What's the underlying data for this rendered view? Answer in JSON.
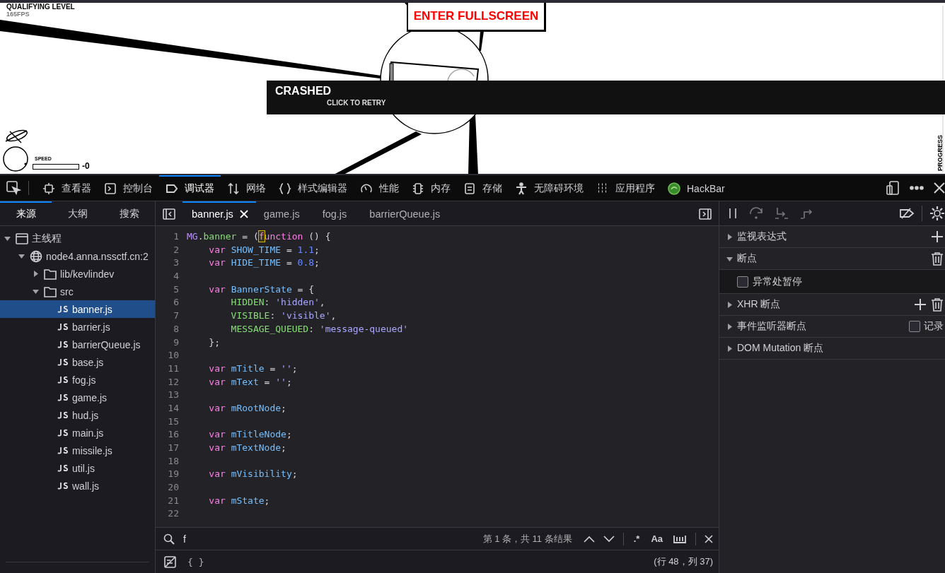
{
  "game": {
    "level_title": "QUALIFYING LEVEL",
    "fps": "165FPS",
    "fullscreen_button": "ENTER FULLSCREEN",
    "banner": {
      "title": "CRASHED",
      "subtitle": "CLICK TO RETRY"
    },
    "speed": {
      "label": "SPEED",
      "value": "-0",
      "level": 0
    },
    "progress_label": "PROGRESS"
  },
  "toolbar": {
    "tabs": [
      {
        "kind": "inspector",
        "label": "查看器",
        "selected": false
      },
      {
        "kind": "console",
        "label": "控制台",
        "selected": false
      },
      {
        "kind": "debugger",
        "label": "调试器",
        "selected": true
      },
      {
        "kind": "network",
        "label": "网络",
        "selected": false
      },
      {
        "kind": "style",
        "label": "样式编辑器",
        "selected": false
      },
      {
        "kind": "performance",
        "label": "性能",
        "selected": false
      },
      {
        "kind": "memory",
        "label": "内存",
        "selected": false
      },
      {
        "kind": "storage",
        "label": "存储",
        "selected": false
      },
      {
        "kind": "accessibility",
        "label": "无障碍环境",
        "selected": false
      },
      {
        "kind": "application",
        "label": "应用程序",
        "selected": false
      },
      {
        "kind": "extension",
        "label": "HackBar",
        "selected": false
      }
    ]
  },
  "sidebar": {
    "tabs": [
      {
        "label": "来源",
        "selected": true
      },
      {
        "label": "大纲",
        "selected": false
      },
      {
        "label": "搜索",
        "selected": false
      }
    ],
    "tree": [
      {
        "kind": "thread",
        "label": "主线程",
        "expanded": true,
        "children": [
          {
            "kind": "host",
            "label": "node4.anna.nssctf.cn:2",
            "expanded": true,
            "children": [
              {
                "kind": "folder",
                "label": "lib/kevlindev",
                "expanded": false
              },
              {
                "kind": "folder",
                "label": "src",
                "expanded": true,
                "children": [
                  {
                    "kind": "file",
                    "label": "banner.js",
                    "selected": true
                  },
                  {
                    "kind": "file",
                    "label": "barrier.js",
                    "selected": false
                  },
                  {
                    "kind": "file",
                    "label": "barrierQueue.js",
                    "selected": false
                  },
                  {
                    "kind": "file",
                    "label": "base.js",
                    "selected": false
                  },
                  {
                    "kind": "file",
                    "label": "fog.js",
                    "selected": false
                  },
                  {
                    "kind": "file",
                    "label": "game.js",
                    "selected": false
                  },
                  {
                    "kind": "file",
                    "label": "hud.js",
                    "selected": false
                  },
                  {
                    "kind": "file",
                    "label": "main.js",
                    "selected": false
                  },
                  {
                    "kind": "file",
                    "label": "missile.js",
                    "selected": false
                  },
                  {
                    "kind": "file",
                    "label": "util.js",
                    "selected": false
                  },
                  {
                    "kind": "file",
                    "label": "wall.js",
                    "selected": false
                  }
                ]
              }
            ]
          }
        ]
      }
    ]
  },
  "editor": {
    "tabs": [
      {
        "label": "banner.js",
        "selected": true
      },
      {
        "label": "game.js",
        "selected": false
      },
      {
        "label": "fog.js",
        "selected": false
      },
      {
        "label": "barrierQueue.js",
        "selected": false
      }
    ],
    "lines": [
      {
        "number": "1",
        "tokens": [
          {
            "kind": "object",
            "text": "MG"
          },
          {
            "kind": "plain",
            "text": "."
          },
          {
            "kind": "property",
            "text": "banner"
          },
          {
            "kind": "plain",
            "text": " = ("
          },
          {
            "kind": "match",
            "text": "f"
          },
          {
            "kind": "keyword",
            "text": "unction"
          },
          {
            "kind": "plain",
            "text": " () {"
          }
        ]
      },
      {
        "number": "2",
        "tokens": [
          {
            "kind": "keyword",
            "text": "    var "
          },
          {
            "kind": "variable",
            "text": "SHOW_TIME"
          },
          {
            "kind": "plain",
            "text": " = "
          },
          {
            "kind": "number",
            "text": "1.1"
          },
          {
            "kind": "plain",
            "text": ";"
          }
        ]
      },
      {
        "number": "3",
        "tokens": [
          {
            "kind": "keyword",
            "text": "    var "
          },
          {
            "kind": "variable",
            "text": "HIDE_TIME"
          },
          {
            "kind": "plain",
            "text": " = "
          },
          {
            "kind": "number",
            "text": "0.8"
          },
          {
            "kind": "plain",
            "text": ";"
          }
        ]
      },
      {
        "number": "4"
      },
      {
        "number": "5",
        "tokens": [
          {
            "kind": "keyword",
            "text": "    var "
          },
          {
            "kind": "variable",
            "text": "BannerState"
          },
          {
            "kind": "plain",
            "text": " = {"
          }
        ]
      },
      {
        "number": "6",
        "tokens": [
          {
            "kind": "property",
            "text": "        HIDDEN"
          },
          {
            "kind": "plain",
            "text": ": "
          },
          {
            "kind": "string",
            "text": "'hidden'"
          },
          {
            "kind": "plain",
            "text": ","
          }
        ]
      },
      {
        "number": "7",
        "tokens": [
          {
            "kind": "property",
            "text": "        VISIBLE"
          },
          {
            "kind": "plain",
            "text": ": "
          },
          {
            "kind": "string",
            "text": "'visible'"
          },
          {
            "kind": "plain",
            "text": ","
          }
        ]
      },
      {
        "number": "8",
        "tokens": [
          {
            "kind": "property",
            "text": "        MESSAGE_QUEUED"
          },
          {
            "kind": "plain",
            "text": ": "
          },
          {
            "kind": "string",
            "text": "'message-queued'"
          }
        ]
      },
      {
        "number": "9",
        "tokens": [
          {
            "kind": "plain",
            "text": "    };"
          }
        ]
      },
      {
        "number": "10"
      },
      {
        "number": "11",
        "tokens": [
          {
            "kind": "keyword",
            "text": "    var "
          },
          {
            "kind": "variable",
            "text": "mTitle"
          },
          {
            "kind": "plain",
            "text": " = "
          },
          {
            "kind": "string",
            "text": "''"
          },
          {
            "kind": "plain",
            "text": ";"
          }
        ]
      },
      {
        "number": "12",
        "tokens": [
          {
            "kind": "keyword",
            "text": "    var "
          },
          {
            "kind": "variable",
            "text": "mText"
          },
          {
            "kind": "plain",
            "text": " = "
          },
          {
            "kind": "string",
            "text": "''"
          },
          {
            "kind": "plain",
            "text": ";"
          }
        ]
      },
      {
        "number": "13"
      },
      {
        "number": "14",
        "tokens": [
          {
            "kind": "keyword",
            "text": "    var "
          },
          {
            "kind": "variable",
            "text": "mRootNode"
          },
          {
            "kind": "plain",
            "text": ";"
          }
        ]
      },
      {
        "number": "15"
      },
      {
        "number": "16",
        "tokens": [
          {
            "kind": "keyword",
            "text": "    var "
          },
          {
            "kind": "variable",
            "text": "mTitleNode"
          },
          {
            "kind": "plain",
            "text": ";"
          }
        ]
      },
      {
        "number": "17",
        "tokens": [
          {
            "kind": "keyword",
            "text": "    var "
          },
          {
            "kind": "variable",
            "text": "mTextNode"
          },
          {
            "kind": "plain",
            "text": ";"
          }
        ]
      },
      {
        "number": "18"
      },
      {
        "number": "19",
        "tokens": [
          {
            "kind": "keyword",
            "text": "    var "
          },
          {
            "kind": "variable",
            "text": "mVisibility"
          },
          {
            "kind": "plain",
            "text": ";"
          }
        ]
      },
      {
        "number": "20"
      },
      {
        "number": "21",
        "tokens": [
          {
            "kind": "keyword",
            "text": "    var "
          },
          {
            "kind": "variable",
            "text": "mState"
          },
          {
            "kind": "plain",
            "text": ";"
          }
        ]
      },
      {
        "number": "22"
      }
    ],
    "search": {
      "value": "f",
      "result": "第 1 条，共 11 条结果",
      "regex_toggle": ".*",
      "case_toggle": "Aa"
    },
    "footer": {
      "pretty_print": "{ }",
      "position": "(行 48，列 37)"
    }
  },
  "debugger": {
    "sections": [
      {
        "label": "监视表达式",
        "expanded": false,
        "add_button": true
      },
      {
        "label": "断点",
        "expanded": true,
        "delete_button": true,
        "option": {
          "label": "异常处暂停",
          "checked": false
        }
      },
      {
        "label": "XHR 断点",
        "expanded": false,
        "add_button": true,
        "delete_button": true
      },
      {
        "label": "事件监听器断点",
        "expanded": false,
        "checkbox": {
          "label": "记录",
          "checked": false
        }
      },
      {
        "label": "DOM Mutation 断点",
        "expanded": false
      }
    ]
  }
}
